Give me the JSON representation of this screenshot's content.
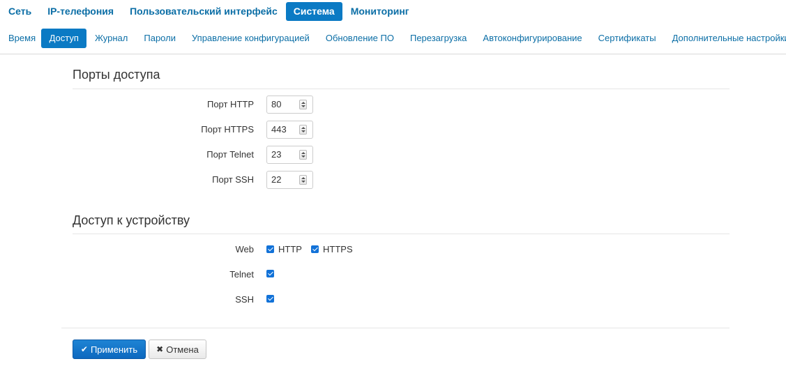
{
  "top_nav": [
    {
      "label": "Сеть",
      "active": false
    },
    {
      "label": "IP-телефония",
      "active": false
    },
    {
      "label": "Пользовательский интерфейс",
      "active": false
    },
    {
      "label": "Система",
      "active": true
    },
    {
      "label": "Мониторинг",
      "active": false
    }
  ],
  "sub_nav": [
    {
      "label": "Время",
      "active": false
    },
    {
      "label": "Доступ",
      "active": true
    },
    {
      "label": "Журнал",
      "active": false
    },
    {
      "label": "Пароли",
      "active": false
    },
    {
      "label": "Управление конфигурацией",
      "active": false
    },
    {
      "label": "Обновление ПО",
      "active": false
    },
    {
      "label": "Перезагрузка",
      "active": false
    },
    {
      "label": "Автоконфигурирование",
      "active": false
    },
    {
      "label": "Сертификаты",
      "active": false
    },
    {
      "label": "Дополнительные настройки",
      "active": false
    }
  ],
  "ports_section": {
    "title": "Порты доступа",
    "ports": [
      {
        "label": "Порт HTTP",
        "value": "80"
      },
      {
        "label": "Порт HTTPS",
        "value": "443"
      },
      {
        "label": "Порт Telnet",
        "value": "23"
      },
      {
        "label": "Порт SSH",
        "value": "22"
      }
    ]
  },
  "access_section": {
    "title": "Доступ к устройству",
    "web_label": "Web",
    "http_label": "HTTP",
    "http_checked": true,
    "https_label": "HTTPS",
    "https_checked": true,
    "telnet_label": "Telnet",
    "telnet_checked": true,
    "ssh_label": "SSH",
    "ssh_checked": true
  },
  "buttons": {
    "apply_label": "Применить",
    "cancel_label": "Отмена"
  },
  "colors": {
    "accent": "#0b7ac4",
    "link": "#0b6ea6",
    "checkbox": "#1272d8"
  }
}
